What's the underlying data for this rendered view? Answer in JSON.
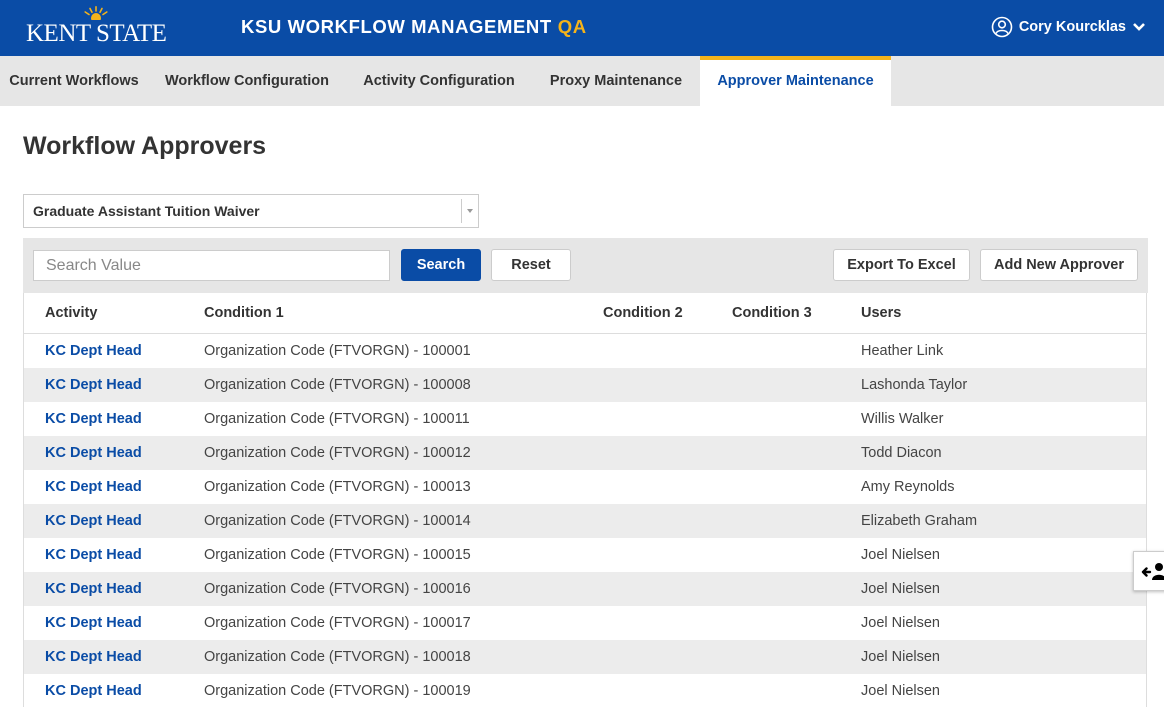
{
  "header": {
    "logo_text": "KENT STATE",
    "title": "KSU WORKFLOW MANAGEMENT",
    "environment": "QA",
    "user_name": "Cory Kourcklas",
    "icons": [
      "user-circle-icon",
      "chevron-down-icon"
    ],
    "colors": {
      "bar": "#0a4ca6",
      "accent": "#f4b31a"
    }
  },
  "nav": {
    "tabs": [
      {
        "label": "Current Workflows",
        "active": false
      },
      {
        "label": "Workflow Configuration",
        "active": false
      },
      {
        "label": "Activity Configuration",
        "active": false
      },
      {
        "label": "Proxy Maintenance",
        "active": false
      },
      {
        "label": "Approver Maintenance",
        "active": true
      }
    ]
  },
  "page": {
    "title": "Workflow Approvers",
    "workflow_select": {
      "value": "Graduate Assistant Tuition Waiver"
    }
  },
  "toolbar": {
    "search_placeholder": "Search Value",
    "search_value": "",
    "search_label": "Search",
    "reset_label": "Reset",
    "export_label": "Export To Excel",
    "add_label": "Add New Approver"
  },
  "table": {
    "headers": [
      "Activity",
      "Condition 1",
      "Condition 2",
      "Condition 3",
      "Users"
    ],
    "rows": [
      {
        "activity": "KC Dept Head",
        "condition1": "Organization Code (FTVORGN) - 100001",
        "condition2": "",
        "condition3": "",
        "users": "Heather Link"
      },
      {
        "activity": "KC Dept Head",
        "condition1": "Organization Code (FTVORGN) - 100008",
        "condition2": "",
        "condition3": "",
        "users": "Lashonda Taylor"
      },
      {
        "activity": "KC Dept Head",
        "condition1": "Organization Code (FTVORGN) - 100011",
        "condition2": "",
        "condition3": "",
        "users": "Willis Walker"
      },
      {
        "activity": "KC Dept Head",
        "condition1": "Organization Code (FTVORGN) - 100012",
        "condition2": "",
        "condition3": "",
        "users": "Todd Diacon"
      },
      {
        "activity": "KC Dept Head",
        "condition1": "Organization Code (FTVORGN) - 100013",
        "condition2": "",
        "condition3": "",
        "users": "Amy Reynolds"
      },
      {
        "activity": "KC Dept Head",
        "condition1": "Organization Code (FTVORGN) - 100014",
        "condition2": "",
        "condition3": "",
        "users": "Elizabeth Graham"
      },
      {
        "activity": "KC Dept Head",
        "condition1": "Organization Code (FTVORGN) - 100015",
        "condition2": "",
        "condition3": "",
        "users": "Joel Nielsen"
      },
      {
        "activity": "KC Dept Head",
        "condition1": "Organization Code (FTVORGN) - 100016",
        "condition2": "",
        "condition3": "",
        "users": "Joel Nielsen"
      },
      {
        "activity": "KC Dept Head",
        "condition1": "Organization Code (FTVORGN) - 100017",
        "condition2": "",
        "condition3": "",
        "users": "Joel Nielsen"
      },
      {
        "activity": "KC Dept Head",
        "condition1": "Organization Code (FTVORGN) - 100018",
        "condition2": "",
        "condition3": "",
        "users": "Joel Nielsen"
      },
      {
        "activity": "KC Dept Head",
        "condition1": "Organization Code (FTVORGN) - 100019",
        "condition2": "",
        "condition3": "",
        "users": "Joel Nielsen"
      }
    ]
  },
  "side_widget": {
    "icon": "exit-user-icon"
  }
}
